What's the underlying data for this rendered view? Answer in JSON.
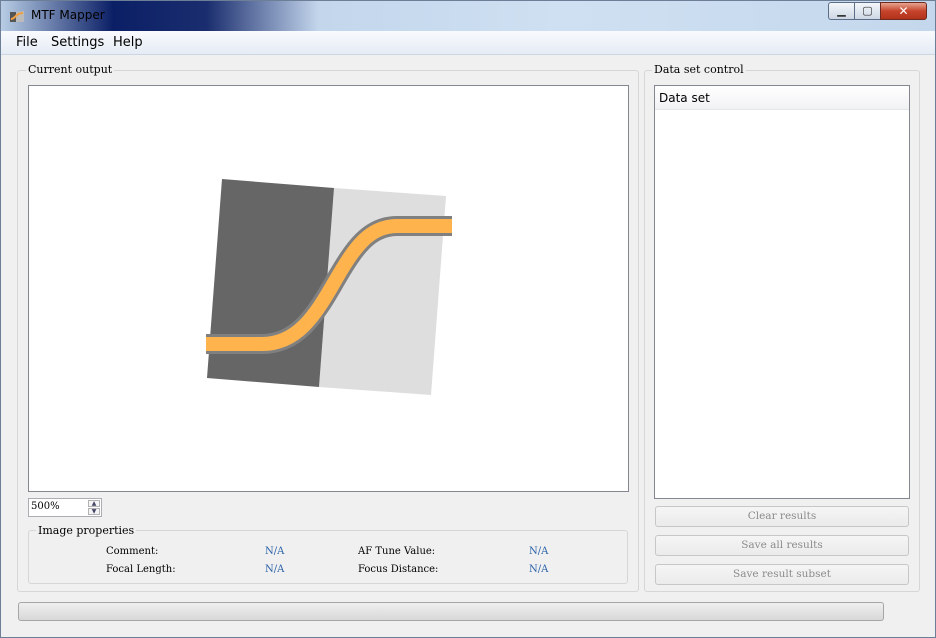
{
  "window": {
    "title": "MTF Mapper"
  },
  "menu": [
    "File",
    "Settings",
    "Help"
  ],
  "output_group": {
    "title": "Current output"
  },
  "zoom": {
    "value": "500%"
  },
  "image_properties": {
    "title": "Image properties",
    "comment_label": "Comment:",
    "comment_value": "N/A",
    "focal_length_label": "Focal Length:",
    "focal_length_value": "N/A",
    "af_tune_label": "AF Tune Value:",
    "af_tune_value": "N/A",
    "focus_distance_label": "Focus Distance:",
    "focus_distance_value": "N/A"
  },
  "dataset_control": {
    "title": "Data set control",
    "column_header": "Data set",
    "buttons": {
      "clear": "Clear results",
      "save_all": "Save all results",
      "save_subset": "Save result subset"
    }
  },
  "progress": {
    "value": 0
  },
  "icons": {
    "app": "mtf-mapper-app-icon",
    "window_controls": [
      "minimize-icon",
      "maximize-icon",
      "close-icon"
    ]
  },
  "colors": {
    "dark_region": "#666666",
    "light_region": "#dedede",
    "curve_fill": "#ffb34d",
    "curve_outline": "#808080",
    "property_value": "#2a62a8"
  }
}
